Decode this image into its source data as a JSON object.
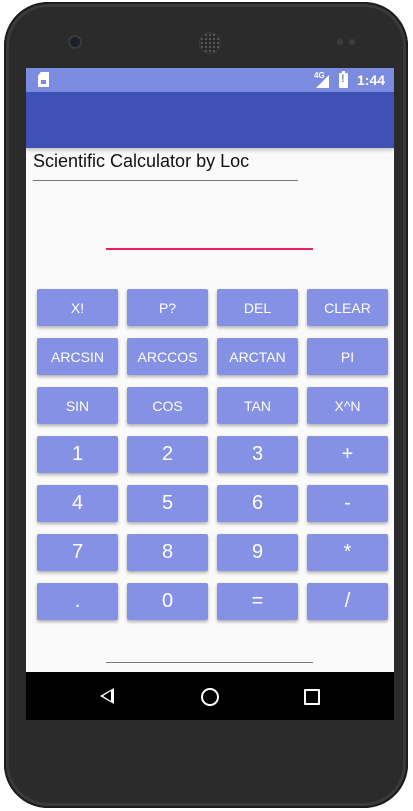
{
  "status_bar": {
    "network": "4G",
    "time": "1:44"
  },
  "app": {
    "title": "Scientific Calculator by Loc",
    "display": {
      "value": "",
      "placeholder": ""
    },
    "accent_color": "#3f51b5",
    "status_color": "#7b8be0",
    "button_color": "#8591e4",
    "underline_color": "#e91e63"
  },
  "keys": [
    {
      "label": "X!",
      "name": "factorial-key"
    },
    {
      "label": "P?",
      "name": "permutation-key"
    },
    {
      "label": "DEL",
      "name": "delete-key"
    },
    {
      "label": "CLEAR",
      "name": "clear-key"
    },
    {
      "label": "ARCSIN",
      "name": "arcsin-key"
    },
    {
      "label": "ARCCOS",
      "name": "arccos-key"
    },
    {
      "label": "ARCTAN",
      "name": "arctan-key"
    },
    {
      "label": "PI",
      "name": "pi-key"
    },
    {
      "label": "SIN",
      "name": "sin-key"
    },
    {
      "label": "COS",
      "name": "cos-key"
    },
    {
      "label": "TAN",
      "name": "tan-key"
    },
    {
      "label": "X^N",
      "name": "power-key"
    },
    {
      "label": "1",
      "name": "digit-1-key",
      "big": true
    },
    {
      "label": "2",
      "name": "digit-2-key",
      "big": true
    },
    {
      "label": "3",
      "name": "digit-3-key",
      "big": true
    },
    {
      "label": "+",
      "name": "plus-key",
      "big": true
    },
    {
      "label": "4",
      "name": "digit-4-key",
      "big": true
    },
    {
      "label": "5",
      "name": "digit-5-key",
      "big": true
    },
    {
      "label": "6",
      "name": "digit-6-key",
      "big": true
    },
    {
      "label": "-",
      "name": "minus-key",
      "big": true
    },
    {
      "label": "7",
      "name": "digit-7-key",
      "big": true
    },
    {
      "label": "8",
      "name": "digit-8-key",
      "big": true
    },
    {
      "label": "9",
      "name": "digit-9-key",
      "big": true
    },
    {
      "label": "*",
      "name": "multiply-key",
      "big": true
    },
    {
      "label": ".",
      "name": "decimal-key",
      "big": true
    },
    {
      "label": "0",
      "name": "digit-0-key",
      "big": true
    },
    {
      "label": "=",
      "name": "equals-key",
      "big": true
    },
    {
      "label": "/",
      "name": "divide-key",
      "big": true
    }
  ],
  "nav_bar": {
    "icons": [
      "back-icon",
      "home-icon",
      "recents-icon"
    ]
  }
}
